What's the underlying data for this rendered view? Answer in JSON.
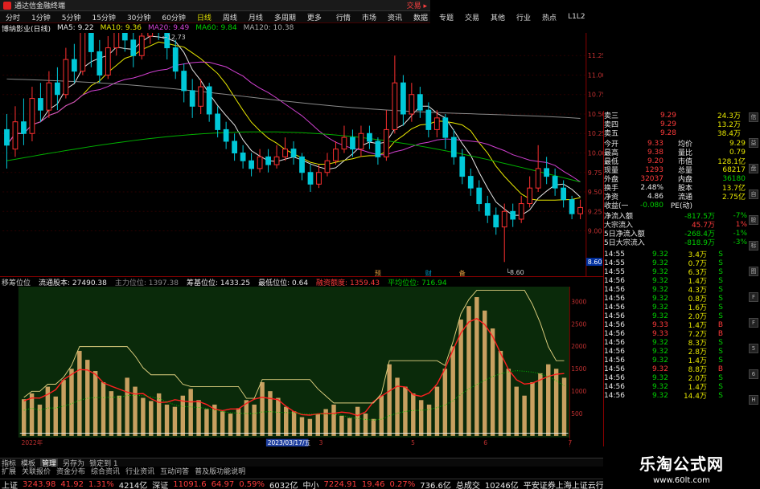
{
  "titlebar": {
    "title": "通达信金融终端",
    "right": "交易 ▸"
  },
  "menubar": {
    "periods": [
      "分时",
      "1分钟",
      "5分钟",
      "15分钟",
      "30分钟",
      "60分钟",
      "日线",
      "周线",
      "月线",
      "多周期",
      "更多"
    ],
    "active_period": "日线",
    "nav": [
      "行情",
      "市场",
      "资讯",
      "数据",
      "专题",
      "交易",
      "其他",
      "行业",
      "热点",
      "L1L2"
    ]
  },
  "main_chart": {
    "stock_label": "博纳影业(日线)",
    "ma": [
      {
        "label": "MA5: 9.22",
        "color": "#e8e8e8"
      },
      {
        "label": "MA10: 9.36",
        "color": "#e8e800"
      },
      {
        "label": "MA20: 9.49",
        "color": "#d040d0"
      },
      {
        "label": "MA60: 9.84",
        "color": "#00d000"
      },
      {
        "label": "MA120: 10.38",
        "color": "#aaaaaa"
      }
    ],
    "high_marker": "12.73",
    "low_marker": "8.60",
    "current_tag": "8.60",
    "price_ticks": [
      "11.25",
      "11.00",
      "10.75",
      "10.50",
      "10.25",
      "10.00",
      "9.75",
      "9.50",
      "9.25",
      "9.00"
    ],
    "event_marks": [
      "预",
      "财",
      "备"
    ]
  },
  "sub_chart": {
    "legend": [
      {
        "label": "移筹位位",
        "color": "#cccccc"
      },
      {
        "label": "流通股本: 27490.38",
        "color": "#e8e8e8"
      },
      {
        "label": "主力位位: 1397.38",
        "color": "#888888"
      },
      {
        "label": "筹基位位: 1433.25",
        "color": "#e8e8e8"
      },
      {
        "label": "最低位位: 0.64",
        "color": "#e8e8e8"
      },
      {
        "label": "融资额度: 1359.43",
        "color": "#ff3b3b"
      },
      {
        "label": "平均位位: 716.94",
        "color": "#00d000"
      }
    ],
    "y_ticks": [
      "3000",
      "2500",
      "2000",
      "1500",
      "1000",
      "500"
    ],
    "x_labels": [
      {
        "t": "2022年",
        "x": 4
      },
      {
        "t": "2023/03/17/五",
        "x": 330
      },
      {
        "t": "3",
        "x": 398
      },
      {
        "t": "5",
        "x": 520
      },
      {
        "t": "6",
        "x": 616
      },
      {
        "t": "7",
        "x": 728
      }
    ]
  },
  "chart_data": {
    "type": "candlestick",
    "title": "",
    "xlabel": "",
    "ylabel": "",
    "ylim": [
      8.5,
      11.5
    ],
    "candles": [
      [
        10.3,
        10.1,
        10.5,
        9.8
      ],
      [
        10.05,
        10.4,
        10.6,
        9.95
      ],
      [
        10.4,
        10.25,
        10.7,
        10.1
      ],
      [
        10.25,
        10.7,
        10.85,
        10.15
      ],
      [
        10.7,
        10.55,
        10.9,
        10.4
      ],
      [
        10.55,
        10.9,
        11.05,
        10.45
      ],
      [
        10.9,
        10.75,
        11.1,
        10.55
      ],
      [
        10.75,
        11.2,
        11.35,
        10.7
      ],
      [
        11.2,
        11.05,
        11.4,
        10.9
      ],
      [
        11.05,
        11.55,
        11.7,
        11.0
      ],
      [
        11.55,
        11.3,
        11.75,
        11.1
      ],
      [
        11.3,
        11.0,
        11.45,
        10.9
      ],
      [
        11.0,
        11.35,
        11.5,
        10.95
      ],
      [
        11.35,
        11.6,
        11.85,
        11.25
      ],
      [
        11.6,
        11.45,
        11.8,
        11.3
      ],
      [
        11.45,
        11.25,
        11.6,
        11.1
      ],
      [
        11.25,
        11.5,
        11.7,
        11.2
      ],
      [
        11.5,
        11.7,
        11.9,
        11.4
      ],
      [
        11.7,
        11.55,
        11.95,
        11.45
      ],
      [
        11.55,
        11.35,
        11.65,
        11.2
      ],
      [
        11.35,
        11.05,
        11.45,
        10.95
      ],
      [
        11.05,
        10.8,
        11.15,
        10.65
      ],
      [
        10.8,
        10.6,
        10.95,
        10.45
      ],
      [
        10.6,
        10.85,
        10.95,
        10.5
      ],
      [
        10.85,
        10.5,
        10.9,
        10.4
      ],
      [
        10.5,
        10.3,
        10.6,
        10.2
      ],
      [
        10.3,
        10.15,
        10.4,
        10.05
      ],
      [
        10.15,
        10.0,
        10.25,
        9.9
      ],
      [
        10.0,
        9.9,
        10.1,
        9.8
      ],
      [
        9.9,
        9.8,
        10.0,
        9.7
      ],
      [
        9.8,
        9.95,
        10.05,
        9.75
      ],
      [
        9.95,
        9.85,
        10.05,
        9.75
      ],
      [
        9.85,
        9.95,
        10.1,
        9.8
      ],
      [
        9.95,
        10.05,
        10.2,
        9.9
      ],
      [
        10.05,
        9.95,
        10.15,
        9.85
      ],
      [
        9.95,
        9.75,
        10.0,
        9.65
      ],
      [
        9.75,
        9.6,
        9.85,
        9.5
      ],
      [
        9.6,
        9.75,
        9.85,
        9.55
      ],
      [
        9.75,
        9.9,
        10.0,
        9.7
      ],
      [
        9.9,
        10.05,
        10.15,
        9.85
      ],
      [
        10.05,
        10.2,
        10.35,
        10.0
      ],
      [
        10.2,
        10.05,
        10.3,
        9.95
      ],
      [
        10.05,
        10.25,
        10.35,
        9.95
      ],
      [
        10.25,
        10.15,
        10.35,
        10.05
      ],
      [
        10.15,
        9.95,
        10.2,
        9.85
      ],
      [
        9.95,
        10.3,
        10.55,
        9.9
      ],
      [
        10.3,
        10.9,
        11.25,
        10.25
      ],
      [
        10.9,
        10.5,
        11.0,
        10.35
      ],
      [
        10.5,
        10.75,
        10.9,
        10.4
      ],
      [
        10.75,
        10.55,
        10.85,
        10.45
      ],
      [
        10.55,
        10.3,
        10.65,
        10.2
      ],
      [
        10.3,
        10.45,
        10.55,
        10.2
      ],
      [
        10.45,
        10.2,
        10.5,
        10.05
      ],
      [
        10.2,
        9.95,
        10.3,
        9.85
      ],
      [
        9.95,
        9.7,
        10.05,
        9.6
      ],
      [
        9.7,
        9.55,
        9.8,
        9.45
      ],
      [
        9.55,
        9.35,
        9.65,
        9.25
      ],
      [
        9.35,
        9.2,
        9.45,
        9.1
      ],
      [
        9.2,
        9.05,
        9.3,
        8.95
      ],
      [
        9.05,
        9.25,
        9.35,
        8.6
      ],
      [
        9.25,
        9.15,
        9.35,
        9.05
      ],
      [
        9.15,
        9.35,
        9.45,
        9.1
      ],
      [
        9.35,
        9.55,
        9.7,
        9.3
      ],
      [
        9.55,
        9.8,
        10.1,
        9.5
      ],
      [
        9.8,
        9.7,
        9.95,
        9.6
      ],
      [
        9.7,
        9.55,
        9.8,
        9.45
      ],
      [
        9.55,
        9.4,
        9.65,
        9.3
      ],
      [
        9.4,
        9.22,
        9.45,
        9.15
      ],
      [
        9.22,
        9.3,
        9.4,
        9.15
      ]
    ],
    "volume": [
      820,
      950,
      700,
      1100,
      880,
      1250,
      1500,
      1900,
      1700,
      1450,
      1200,
      1000,
      900,
      1300,
      1100,
      850,
      780,
      950,
      700,
      650,
      900,
      1050,
      800,
      600,
      700,
      550,
      500,
      620,
      800,
      700,
      1200,
      1000,
      850,
      650,
      550,
      420,
      380,
      500,
      600,
      700,
      450,
      400,
      650,
      500,
      380,
      900,
      1600,
      1300,
      1100,
      950,
      800,
      700,
      1100,
      1500,
      2000,
      2600,
      2900,
      3100,
      2800,
      2400,
      1900,
      1500,
      1100,
      900,
      1200,
      1400,
      1600,
      1500,
      1300
    ],
    "ylim_sub": [
      0,
      3300
    ]
  },
  "right_panel": {
    "quote_rows": [
      {
        "label": "卖三",
        "price": "9.29",
        "vol": "24.3万"
      },
      {
        "label": "卖四",
        "price": "9.29",
        "vol": "13.2万"
      },
      {
        "label": "卖五",
        "price": "9.28",
        "vol": "38.4万"
      }
    ],
    "info_rows": [
      {
        "l1": "今开",
        "v1": "9.33",
        "l2": "均价",
        "v2": "9.29"
      },
      {
        "l1": "最高",
        "v1": "9.38",
        "l2": "量比",
        "v2": "0.79"
      },
      {
        "l1": "最低",
        "v1": "9.20",
        "l2": "市值",
        "v2": "128.1亿"
      },
      {
        "l1": "现量",
        "v1": "1293",
        "l2": "总量",
        "v2": "68217"
      },
      {
        "l1": "外盘",
        "v1": "32037",
        "l2": "内盘",
        "v2": "36180"
      },
      {
        "l1": "换手",
        "v1": "2.48%",
        "l2": "股本",
        "v2": "13.7亿"
      },
      {
        "l1": "净资",
        "v1": "4.86",
        "l2": "流通",
        "v2": "2.75亿"
      },
      {
        "l1": "收益(一)",
        "v1": "-0.080",
        "l2": "PE(动)",
        "v2": ""
      }
    ],
    "flow_rows": [
      {
        "label": "净流入额",
        "val": "-817.5万",
        "pct": "-7%"
      },
      {
        "label": "大宗流入",
        "val": "45.7万",
        "pct": "1%"
      },
      {
        "label": "5日净流入额",
        "val": "-268.4万",
        "pct": "-1%"
      },
      {
        "label": "5日大宗流入",
        "val": "-818.9万",
        "pct": "-3%"
      }
    ],
    "ticks": [
      {
        "t": "14:55",
        "p": "9.32",
        "v": "3.4万",
        "bs": "S"
      },
      {
        "t": "14:55",
        "p": "9.32",
        "v": "0.7万",
        "bs": "S"
      },
      {
        "t": "14:55",
        "p": "9.32",
        "v": "6.3万",
        "bs": "S"
      },
      {
        "t": "14:56",
        "p": "9.32",
        "v": "1.4万",
        "bs": "S"
      },
      {
        "t": "14:56",
        "p": "9.32",
        "v": "4.3万",
        "bs": "S"
      },
      {
        "t": "14:56",
        "p": "9.32",
        "v": "0.8万",
        "bs": "S"
      },
      {
        "t": "14:56",
        "p": "9.32",
        "v": "1.6万",
        "bs": "S"
      },
      {
        "t": "14:56",
        "p": "9.32",
        "v": "2.0万",
        "bs": "S"
      },
      {
        "t": "14:56",
        "p": "9.33",
        "v": "1.4万",
        "bs": "B"
      },
      {
        "t": "14:56",
        "p": "9.33",
        "v": "7.2万",
        "bs": "B"
      },
      {
        "t": "14:56",
        "p": "9.32",
        "v": "8.3万",
        "bs": "S"
      },
      {
        "t": "14:56",
        "p": "9.32",
        "v": "2.8万",
        "bs": "S"
      },
      {
        "t": "14:56",
        "p": "9.32",
        "v": "1.4万",
        "bs": "S"
      },
      {
        "t": "14:56",
        "p": "9.32",
        "v": "8.8万",
        "bs": "B"
      },
      {
        "t": "14:56",
        "p": "9.32",
        "v": "2.0万",
        "bs": "S"
      },
      {
        "t": "14:56",
        "p": "9.32",
        "v": "1.4万",
        "bs": "S"
      },
      {
        "t": "14:56",
        "p": "9.32",
        "v": "14.4万",
        "bs": "S"
      }
    ]
  },
  "bottom_tabs": [
    "指标",
    "模板",
    "管理",
    "另存为",
    "锁定到 1"
  ],
  "bottom_tabs_active": "管理",
  "bottom_tabs2": [
    "扩展",
    "关联报价",
    "资金分布",
    "综合资讯",
    "行业资讯",
    "互动问答",
    "普及版功能说明"
  ],
  "ticker": [
    {
      "name": "上证",
      "val": "3243.98",
      "chg": "41.92",
      "pct": "1.31%",
      "amt": "4214亿"
    },
    {
      "name": "深证",
      "val": "11091.6",
      "chg": "64.97",
      "pct": "0.59%",
      "amt": "6032亿"
    },
    {
      "name": "中小",
      "val": "7224.91",
      "chg": "19.46",
      "pct": "0.27%",
      "amt": "736.6亿"
    }
  ],
  "ticker_tail": {
    "label": "总成交",
    "val": "10246亿",
    "extra": "平安证券上海上证云行情"
  },
  "watermark": {
    "big": "乐淘公式网",
    "small": "www.60lt.com"
  },
  "side_button_labels": [
    "信",
    "益",
    "盘",
    "自",
    "股",
    "标",
    "图",
    "F",
    "F",
    "5",
    "6",
    "H"
  ]
}
